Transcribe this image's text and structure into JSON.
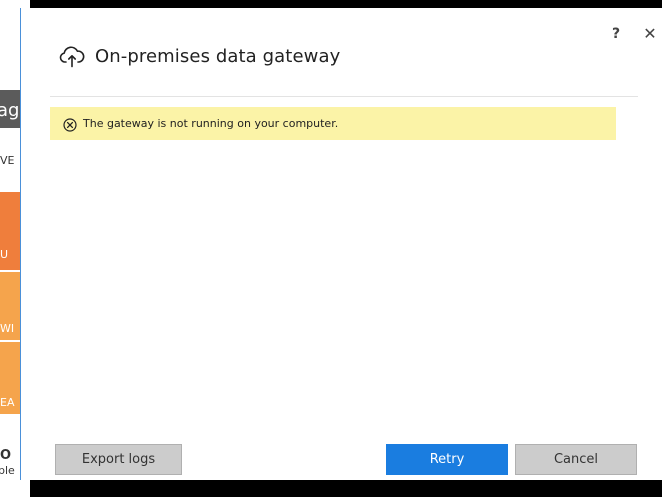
{
  "background_app": {
    "fragments": [
      "ag",
      "VE",
      "U",
      "WI",
      "EA",
      "O",
      "ple"
    ]
  },
  "dialog": {
    "title": "On-premises data gateway",
    "help": "?",
    "close": "✕",
    "alert": {
      "message": "The gateway is not running on your computer.",
      "background": "#fbf3a7"
    },
    "buttons": {
      "export_logs": "Export logs",
      "retry": "Retry",
      "cancel": "Cancel"
    },
    "accent_color": "#1a7de0"
  }
}
